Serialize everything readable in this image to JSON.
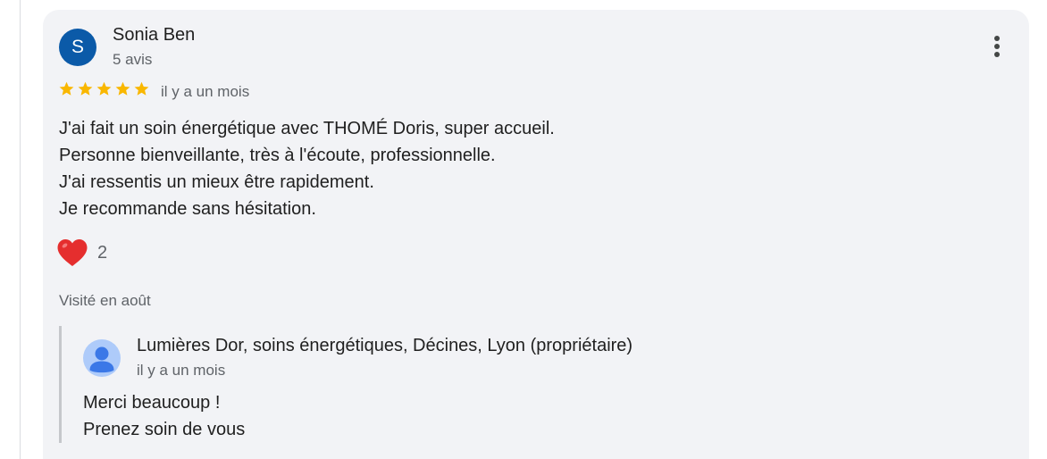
{
  "review": {
    "avatar_letter": "S",
    "avatar_color": "#0b5aa8",
    "reviewer_name": "Sonia Ben",
    "reviewer_review_count": "5 avis",
    "rating": 5,
    "max_rating": 5,
    "star_color": "#f9b700",
    "date": "il y a un mois",
    "text_lines": [
      "J'ai fait un soin énergétique avec THOMÉ Doris, super accueil.",
      "Personne bienveillante, très à l'écoute, professionnelle.",
      "J'ai ressentis un mieux être rapidement.",
      "Je recommande sans hésitation."
    ],
    "reaction_icon": "heart-icon",
    "reaction_count": "2",
    "visited": "Visité en août",
    "menu_icon": "more-vert-icon"
  },
  "reply": {
    "owner_icon": "person-icon",
    "owner_name": "Lumières Dor, soins énergétiques, Décines, Lyon (propriétaire)",
    "date": "il y a un mois",
    "text_lines": [
      "Merci beaucoup !",
      "Prenez soin de vous"
    ]
  },
  "colors": {
    "card_background": "#f2f3f6",
    "secondary_text": "#5f6368",
    "heart": "#e52e2e"
  }
}
